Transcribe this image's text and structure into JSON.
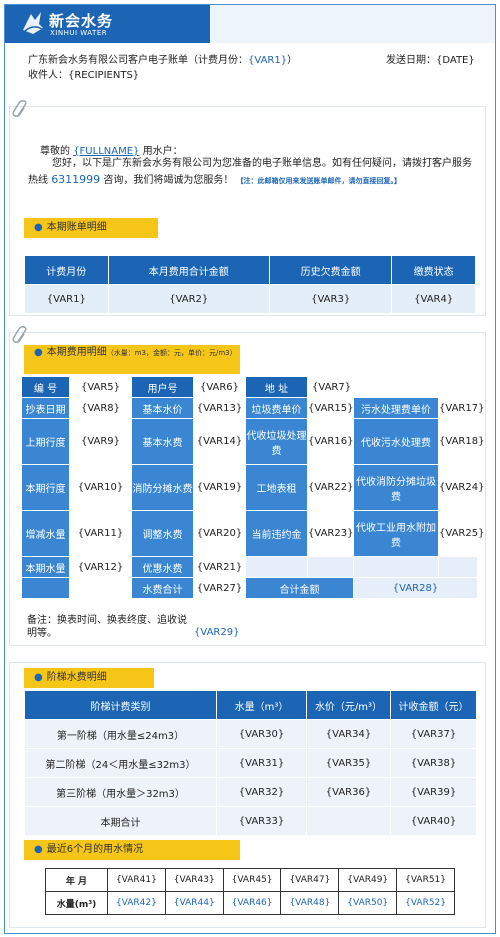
{
  "brand": {
    "name_cn": "新会水务",
    "name_en": "XINHUI WATER"
  },
  "header": {
    "title_prefix": "广东新会水务有限公司客户电子账单（计费月份：",
    "title_var": "{VAR1}",
    "title_suffix": "）",
    "send_date": "发送日期：{DATE}",
    "recipients": "收件人：{RECIPIENTS}"
  },
  "greeting": {
    "prefix": "尊敬的",
    "fullname": "{FULLNAME}",
    "suffix": "用水户：",
    "body": "您好，以下是广东新会水务有限公司为您准备的电子账单信息。如有任何疑问，请拨打客户服务热线",
    "hotline": "6311999",
    "body2": "咨询，我们将竭诚为您服务！",
    "note": "【注：此邮箱仅用来发送账单邮件，请勿直接回复。】"
  },
  "summary": {
    "label": "本期账单明细",
    "headers": [
      "计费月份",
      "本月费用合计金额",
      "历史欠费金额",
      "缴费状态"
    ],
    "values": [
      "{VAR1}",
      "{VAR2}",
      "{VAR3}",
      "{VAR4}"
    ]
  },
  "detail": {
    "label": "本期费用明细",
    "label_unit": "（水量：m3，金额：元，单价：元/m3）",
    "row1": [
      "编 号",
      "{VAR5}",
      "用户号",
      "{VAR6}",
      "地 址",
      "{VAR7}"
    ],
    "rows": [
      [
        "抄表日期",
        "{VAR8}",
        "基本水价",
        "{VAR13}",
        "垃圾费单价",
        "{VAR15}",
        "污水处理费单价",
        "{VAR17}"
      ],
      [
        "上期行度",
        "{VAR9}",
        "基本水费",
        "{VAR14}",
        "代收垃圾处理费",
        "{VAR16}",
        "代收污水处理费",
        "{VAR18}"
      ],
      [
        "本期行度",
        "{VAR10}",
        "消防分摊水费",
        "{VAR19}",
        "工地表租",
        "{VAR22}",
        "代收消防分摊垃圾费",
        "{VAR24}"
      ],
      [
        "增减水量",
        "{VAR11}",
        "调整水费",
        "{VAR20}",
        "当前违约金",
        "{VAR23}",
        "代收工业用水附加费",
        "{VAR25}"
      ],
      [
        "本期水量",
        "{VAR12}",
        "优惠水费",
        "{VAR21}"
      ]
    ],
    "total_water_label": "水费合计",
    "total_water": "{VAR27}",
    "total_amount_label": "合计金额",
    "total_amount": "{VAR28}",
    "memo": "备注：换表时间、换表终度、追收说明等。",
    "memo_var": "{VAR29}"
  },
  "tier": {
    "label": "阶梯水费明细",
    "headers": [
      "阶梯计费类别",
      "水量（m³）",
      "水价（元/m³）",
      "计收金额（元）"
    ],
    "rows": [
      [
        "第一阶梯（用水量≤24m3）",
        "{VAR30}",
        "{VAR34}",
        "{VAR37}"
      ],
      [
        "第二阶梯（24＜用水量≤32m3）",
        "{VAR31}",
        "{VAR35}",
        "{VAR38}"
      ],
      [
        "第三阶梯（用水量＞32m3）",
        "{VAR32}",
        "{VAR36}",
        "{VAR39}"
      ],
      [
        "本期合计",
        "{VAR33}",
        "",
        "{VAR40}"
      ]
    ]
  },
  "recent": {
    "label": "最近6个月的用水情况",
    "row_month_label": "年 月",
    "months": [
      "{VAR41}",
      "{VAR43}",
      "{VAR45}",
      "{VAR47}",
      "{VAR49}",
      "{VAR51}"
    ],
    "row_volume_label": "水量(m³)",
    "volumes": [
      "{VAR42}",
      "{VAR44}",
      "{VAR46}",
      "{VAR48}",
      "{VAR50}",
      "{VAR52}"
    ]
  }
}
